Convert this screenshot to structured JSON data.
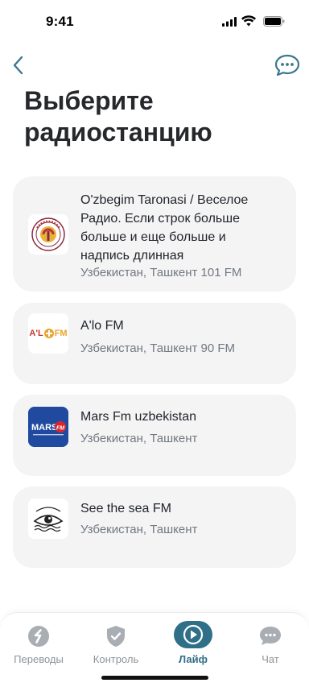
{
  "status_bar": {
    "time": "9:41"
  },
  "header": {
    "title": "Выберите радиостанцию"
  },
  "stations": [
    {
      "name": "O'zbegim Taronasi / Веселое Радио. Если строк больше больше и еще больше и надпись длинная",
      "location": "Узбекистан, Ташкент 101 FM",
      "logo": "ozbegim-taronasi-logo"
    },
    {
      "name": "A'lo FM",
      "location": "Узбекистан, Ташкент 90 FM",
      "logo": "alo-fm-logo",
      "logo_text": "A'L FM"
    },
    {
      "name": "Mars Fm uzbekistan",
      "location": "Узбекистан, Ташкент",
      "logo": "mars-fm-logo",
      "logo_text": "MARS FM"
    },
    {
      "name": "See the sea FM",
      "location": "Узбекистан, Ташкент",
      "logo": "see-the-sea-logo"
    }
  ],
  "tabs": [
    {
      "label": "Переводы",
      "icon": "transfer-icon",
      "active": false
    },
    {
      "label": "Контроль",
      "icon": "shield-icon",
      "active": false
    },
    {
      "label": "Лайф",
      "icon": "play-icon",
      "active": true
    },
    {
      "label": "Чат",
      "icon": "chat-bubble-icon",
      "active": false
    }
  ],
  "colors": {
    "accent": "#2f6f88",
    "card_bg": "#f4f4f5",
    "muted_text": "#727880",
    "tab_inactive": "#8e9499"
  }
}
